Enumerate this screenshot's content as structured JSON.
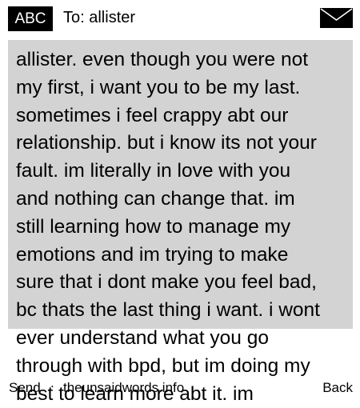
{
  "header": {
    "input_mode": "ABC",
    "recipient_label": "To: allister",
    "envelope_icon": "envelope-icon"
  },
  "message": {
    "body": "allister. even though you were not\nmy first, i  want you to be my last.\nsometimes i feel crappy abt our\nrelationship. but i know its not your\nfault. im literally in love with you\nand nothing can change that. im\nstill learning how to manage my\nemotions and im trying to make\nsure that i dont make you feel bad,\nbc thats the last thing i want. i wont\never understand what you go\nthrough with bpd, but im doing my\nbest to learn more abt it. im"
  },
  "softkeys": {
    "left": "Send",
    "separator": ".",
    "center": "theunsaidwords.info",
    "right": "Back"
  },
  "colors": {
    "background": "#ffffff",
    "message_highlight": "#d3d3d3",
    "text": "#000000",
    "badge_bg": "#000000",
    "badge_text": "#ffffff"
  }
}
